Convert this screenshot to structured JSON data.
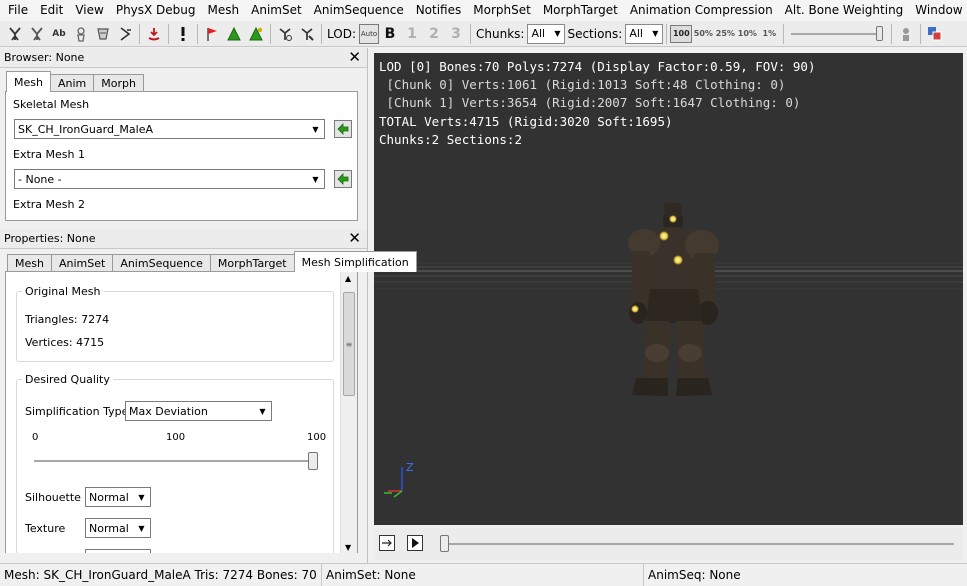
{
  "menu": [
    "File",
    "Edit",
    "View",
    "PhysX Debug",
    "Mesh",
    "AnimSet",
    "AnimSequence",
    "Notifies",
    "MorphSet",
    "MorphTarget",
    "Animation Compression",
    "Alt. Bone Weighting",
    "Window"
  ],
  "toolbar": {
    "ab_label": "Ab",
    "lod_label": "LOD:",
    "lod_auto": "Auto",
    "lod_base": "B",
    "lod_levels": [
      "1",
      "2",
      "3"
    ],
    "chunks_label": "Chunks:",
    "chunks_value": "All",
    "sections_label": "Sections:",
    "sections_value": "All",
    "percents": [
      "100",
      "50%",
      "25%",
      "10%",
      "1%"
    ]
  },
  "browser": {
    "title": "Browser: None",
    "tabs": [
      "Mesh",
      "Anim",
      "Morph"
    ],
    "skeletal_label": "Skeletal Mesh",
    "skeletal_value": "SK_CH_IronGuard_MaleA",
    "extra1_label": "Extra Mesh 1",
    "extra1_value": "- None -",
    "extra2_label": "Extra Mesh 2"
  },
  "properties": {
    "title": "Properties: None",
    "tabs": [
      "Mesh",
      "AnimSet",
      "AnimSequence",
      "MorphTarget",
      "Mesh Simplification"
    ],
    "original_group": "Original Mesh",
    "triangles": "Triangles: 7274",
    "vertices": "Vertices: 4715",
    "quality_group": "Desired Quality",
    "simp_type_label": "Simplification Type",
    "simp_type_value": "Max Deviation",
    "slider_min": "0",
    "slider_mid": "100",
    "slider_max": "100",
    "slider_value": 1.0,
    "silhouette_label": "Silhouette",
    "silhouette_value": "Normal",
    "texture_label": "Texture",
    "texture_value": "Normal"
  },
  "viewport": {
    "info": [
      "LOD [0] Bones:70 Polys:7274 (Display Factor:0.59, FOV: 90)",
      " [Chunk 0] Verts:1061 (Rigid:1013 Soft:48 Clothing: 0)",
      " [Chunk 1] Verts:3654 (Rigid:2007 Soft:1647 Clothing: 0)",
      "TOTAL Verts:4715 (Rigid:3020 Soft:1695)",
      "Chunks:2 Sections:2"
    ],
    "axis_z": "Z"
  },
  "status": {
    "mesh": "Mesh: SK_CH_IronGuard_MaleA  Tris: 7274  Bones: 70",
    "animset": "AnimSet: None",
    "animseq": "AnimSeq: None"
  },
  "colors": {
    "viewport_bg": "#323232",
    "grid_line": "#555555",
    "red_flag": "#e02020",
    "green": "#2b9a1a"
  }
}
